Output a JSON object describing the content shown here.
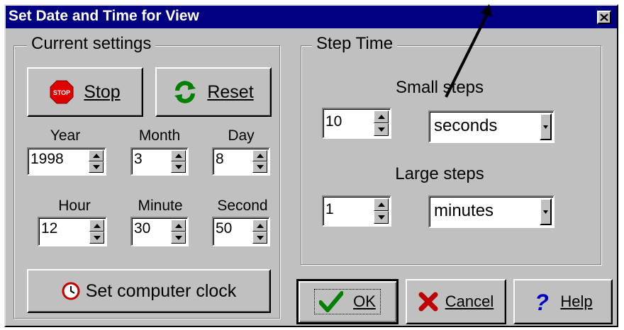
{
  "window": {
    "title": "Set Date and Time for View",
    "close_label": "×"
  },
  "current_settings": {
    "legend": "Current settings",
    "stop_label": "Stop",
    "reset_label": "Reset",
    "fields": {
      "year": {
        "label": "Year",
        "value": "1998"
      },
      "month": {
        "label": "Month",
        "value": "3"
      },
      "day": {
        "label": "Day",
        "value": "8"
      },
      "hour": {
        "label": "Hour",
        "value": "12"
      },
      "minute": {
        "label": "Minute",
        "value": "30"
      },
      "second": {
        "label": "Second",
        "value": "50"
      }
    },
    "set_clock_label": "Set computer clock"
  },
  "step_time": {
    "legend": "Step Time",
    "small": {
      "label": "Small steps",
      "value": "10",
      "unit": "seconds"
    },
    "large": {
      "label": "Large steps",
      "value": "1",
      "unit": "minutes"
    }
  },
  "buttons": {
    "ok": "OK",
    "cancel": "Cancel",
    "help": "Help"
  },
  "icons": [
    "stop-sign-icon",
    "reset-arrows-icon",
    "clock-icon",
    "checkmark-icon",
    "x-icon",
    "question-icon"
  ],
  "colors": {
    "title_bar": "#000080",
    "face": "#c0c0c0"
  }
}
